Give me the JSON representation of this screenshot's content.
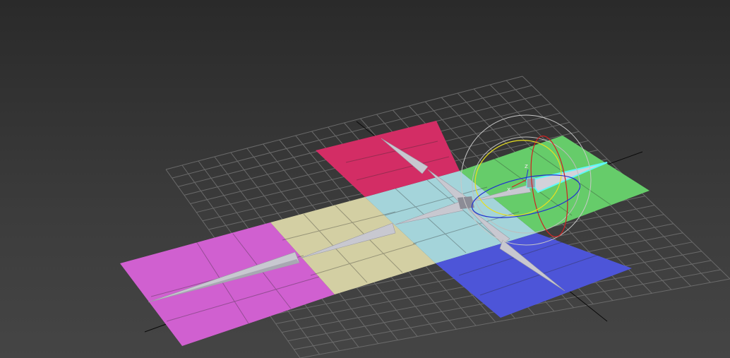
{
  "viewport": {
    "background_top": "#2a2a2a",
    "background_bottom": "#454545",
    "grid_color": "#6f6f6f"
  },
  "scene": {
    "planes": [
      {
        "name": "magenta-plane",
        "color": "#d060d0"
      },
      {
        "name": "beige-plane",
        "color": "#d3cfa3"
      },
      {
        "name": "light-blue-plane",
        "color": "#a4d4da"
      },
      {
        "name": "crimson-plane",
        "color": "#d32d65"
      },
      {
        "name": "green-plane",
        "color": "#66cc6a"
      },
      {
        "name": "blue-plane",
        "color": "#4d55d8"
      }
    ],
    "spike_color": "#c8c8d0",
    "selection_color": "#5ff8f8"
  },
  "gizmo": {
    "axis_z_label": "z",
    "axis_x_label": "x",
    "x_color": "#d02020",
    "y_color": "#e8e020",
    "z_color": "#2030d0",
    "outer_color": "#c8c8c8"
  }
}
